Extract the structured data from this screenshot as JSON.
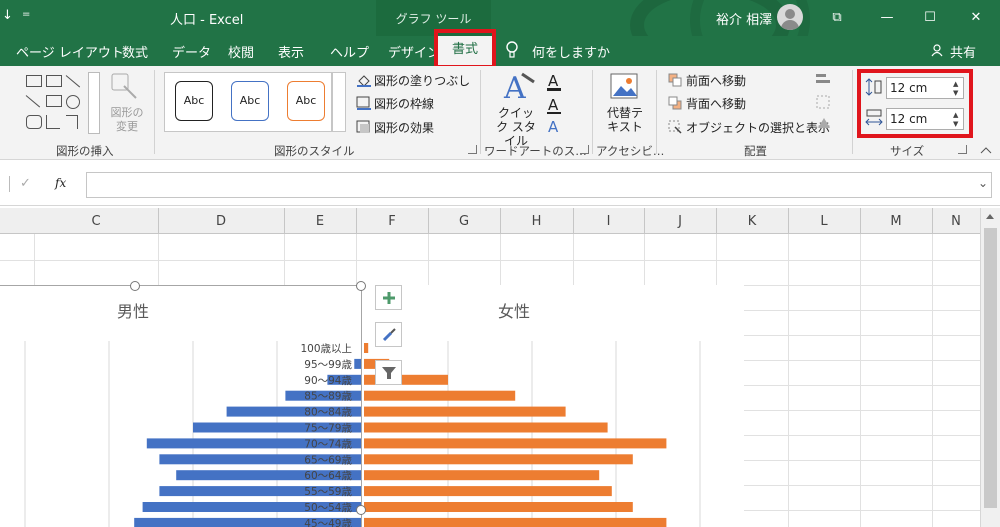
{
  "titlebar": {
    "qat_down": "↓",
    "qat_customize": "=",
    "doc_title": "人口  -  Excel",
    "context_label": "グラフ ツール",
    "user_name": "裕介 相澤",
    "win_restore": "⧉",
    "win_minimize": "—",
    "win_maximize": "☐",
    "win_close": "✕"
  },
  "tabs": [
    "ページ レイアウト",
    "数式",
    "データ",
    "校閲",
    "表示",
    "ヘルプ",
    "デザイン"
  ],
  "active_tab": "書式",
  "tell_me": "何をしますか",
  "share": "共有",
  "ribbon": {
    "insert_group_label": "図形の挿入",
    "change_shape": "図形の変更",
    "style_boxes": [
      "Abc",
      "Abc",
      "Abc"
    ],
    "style_colors": [
      "#222222",
      "#4472c4",
      "#ed7d31"
    ],
    "fill": "図形の塗りつぶし",
    "outline": "図形の枠線",
    "effect": "図形の効果",
    "style_group_label": "図形のスタイル",
    "quick_style": "クイック スタイル",
    "wordart_label": "ワードアートのス…",
    "alt_text": "代替テキスト",
    "access_label": "アクセシビ…",
    "bring_forward": "前面へ移動",
    "send_backward": "背面へ移動",
    "selection_pane": "オブジェクトの選択と表示",
    "arrange_label": "配置",
    "height_value": "12 cm",
    "width_value": "12 cm",
    "size_label": "サイズ"
  },
  "formula": {
    "cancel": "✓",
    "fx": "fx",
    "dropdown": "⌄"
  },
  "columns": [
    "C",
    "D",
    "E",
    "F",
    "G",
    "H",
    "I",
    "J",
    "K",
    "L",
    "M",
    "N"
  ],
  "chart_data": {
    "type": "bar",
    "title_left": "男性",
    "title_right": "女性",
    "categories": [
      "100歳以上",
      "95〜99歳",
      "90〜94歳",
      "85〜89歳",
      "80〜84歳",
      "75〜79歳",
      "70〜74歳",
      "65〜69歳",
      "60〜64歳",
      "55〜59歳",
      "50〜54歳",
      "45〜49歳"
    ],
    "series": [
      {
        "values": [
          0,
          0.08,
          0.4,
          0.9,
          1.6,
          2.0,
          2.55,
          2.4,
          2.2,
          2.4,
          2.6,
          2.7
        ],
        "color": "#4472c4"
      },
      {
        "values": [
          0.05,
          0.3,
          1.0,
          1.8,
          2.4,
          2.9,
          3.6,
          3.2,
          2.8,
          2.95,
          3.2,
          3.6
        ],
        "color": "#ed7d31"
      }
    ],
    "xlim": [
      0,
      4
    ]
  }
}
